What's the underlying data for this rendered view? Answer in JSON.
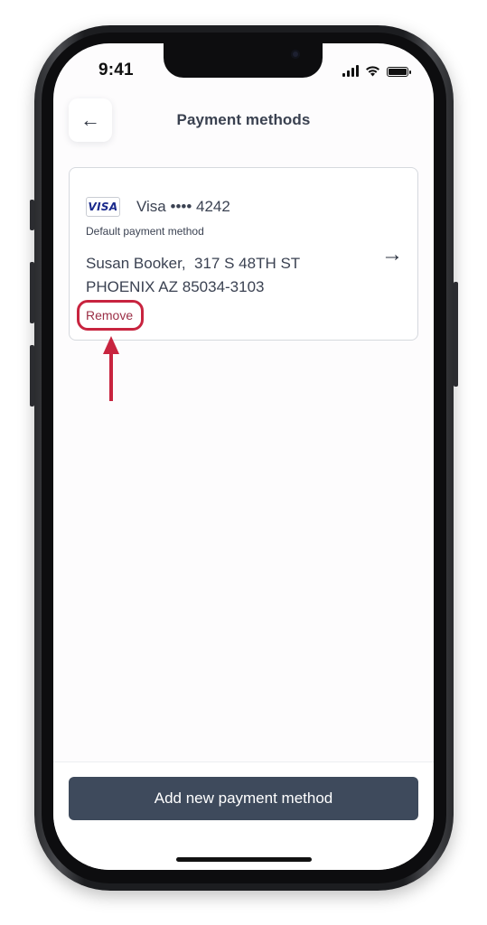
{
  "status_bar": {
    "time": "9:41"
  },
  "header": {
    "back_icon": "←",
    "title": "Payment methods"
  },
  "payment_card": {
    "brand_logo_text": "VISA",
    "brand_line": "Visa •••• 4242",
    "default_label": "Default payment method",
    "address_line_1": "Susan Booker,  317 S 48TH ST",
    "address_line_2": "PHOENIX AZ 85034-3103",
    "remove_label": "Remove",
    "chevron_icon": "→"
  },
  "footer": {
    "add_button_label": "Add new payment method"
  },
  "colors": {
    "primary_button": "#3e4a5c",
    "remove_text": "#9b2f46",
    "annotation_red": "#c8243f",
    "visa_blue": "#1a2a8c"
  }
}
